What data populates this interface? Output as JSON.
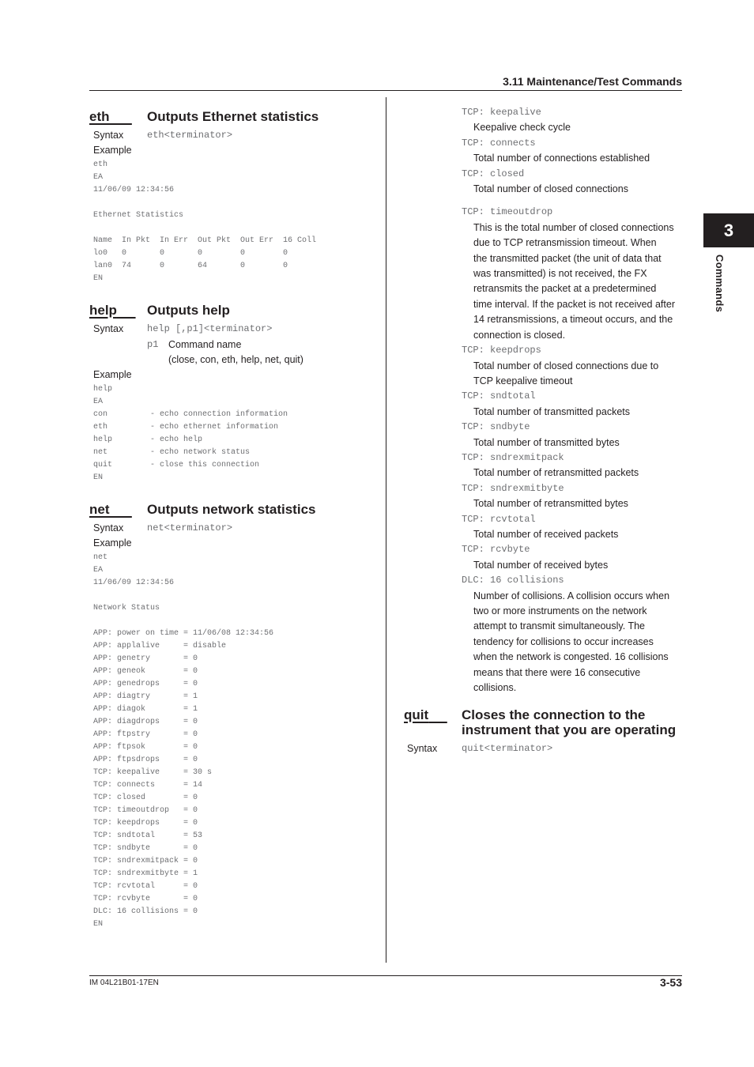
{
  "header": {
    "section_title": "3.11  Maintenance/Test Commands"
  },
  "chapter_tab": {
    "number": "3",
    "label": "Commands"
  },
  "footer": {
    "doc_id": "IM 04L21B01-17EN",
    "page_number": "3-53"
  },
  "labels": {
    "syntax": "Syntax",
    "example": "Example"
  },
  "eth": {
    "name": "eth",
    "title": "Outputs Ethernet statistics",
    "syntax": "eth<terminator>",
    "example_lines": [
      "eth",
      "EA",
      "11/06/09 12:34:56",
      "",
      "Ethernet Statistics",
      "",
      "Name  In Pkt  In Err  Out Pkt  Out Err  16 Coll",
      "lo0   0       0       0        0        0",
      "lan0  74      0       64       0        0",
      "EN"
    ]
  },
  "help": {
    "name": "help",
    "title": "Outputs help",
    "syntax": "help [,p1]<terminator>",
    "param_name": "p1",
    "param_desc": "Command name",
    "param_values": "(close, con, eth, help, net, quit)",
    "example_lines": [
      "help",
      "EA",
      "con         - echo connection information",
      "eth         - echo ethernet information",
      "help        - echo help",
      "net         - echo network status",
      "quit        - close this connection",
      "EN"
    ]
  },
  "net": {
    "name": "net",
    "title": "Outputs network statistics",
    "syntax": "net<terminator>",
    "example_lines": [
      "net",
      "EA",
      "11/06/09 12:34:56",
      "",
      "Network Status",
      "",
      "APP: power on time = 11/06/08 12:34:56",
      "APP: applalive     = disable",
      "APP: genetry       = 0",
      "APP: geneok        = 0",
      "APP: genedrops     = 0",
      "APP: diagtry       = 1",
      "APP: diagok        = 1",
      "APP: diagdrops     = 0",
      "APP: ftpstry       = 0",
      "APP: ftpsok        = 0",
      "APP: ftpsdrops     = 0",
      "TCP: keepalive     = 30 s",
      "TCP: connects      = 14",
      "TCP: closed        = 0",
      "TCP: timeoutdrop   = 0",
      "TCP: keepdrops     = 0",
      "TCP: sndtotal      = 53",
      "TCP: sndbyte       = 0",
      "TCP: sndrexmitpack = 0",
      "TCP: sndrexmitbyte = 1",
      "TCP: rcvtotal      = 0",
      "TCP: rcvbyte       = 0",
      "DLC: 16 collisions = 0",
      "EN"
    ]
  },
  "net_descriptions": [
    {
      "key": "TCP: keepalive",
      "desc": [
        "Keepalive check cycle"
      ]
    },
    {
      "key": "TCP: connects",
      "desc": [
        "Total number of connections established"
      ]
    },
    {
      "key": "TCP: closed",
      "desc": [
        "Total number of closed connections"
      ]
    },
    {
      "key": "TCP: timeoutdrop",
      "desc": [
        "This is the total number of closed connections",
        "due to TCP retransmission timeout. When",
        "the transmitted packet (the unit of data that",
        "was transmitted) is not received, the FX",
        "retransmits the packet at a predetermined",
        "time interval. If the packet is not received after",
        "14 retransmissions, a timeout occurs, and the",
        "connection is closed."
      ]
    },
    {
      "key": "TCP: keepdrops",
      "desc": [
        "Total number of closed connections due to",
        "TCP keepalive timeout"
      ]
    },
    {
      "key": "TCP: sndtotal",
      "desc": [
        "Total number of transmitted packets"
      ]
    },
    {
      "key": "TCP: sndbyte",
      "desc": [
        "Total number of transmitted bytes"
      ]
    },
    {
      "key": "TCP: sndrexmitpack",
      "desc": [
        "Total number of retransmitted packets"
      ]
    },
    {
      "key": "TCP: sndrexmitbyte",
      "desc": [
        "Total number of retransmitted bytes"
      ]
    },
    {
      "key": "TCP: rcvtotal",
      "desc": [
        "Total number of received packets"
      ]
    },
    {
      "key": "TCP: rcvbyte",
      "desc": [
        "Total number of received bytes"
      ]
    },
    {
      "key": "DLC: 16 collisions",
      "desc": [
        "Number of collisions. A collision occurs when",
        "two or more instruments on the network",
        "attempt to transmit simultaneously. The",
        "tendency for collisions to occur increases",
        "when the network is congested. 16 collisions",
        "means that there were 16 consecutive",
        "collisions."
      ]
    }
  ],
  "quit": {
    "name": "quit",
    "title_line1": "Closes the connection to the",
    "title_line2": "instrument that you are operating",
    "syntax": "quit<terminator>"
  }
}
